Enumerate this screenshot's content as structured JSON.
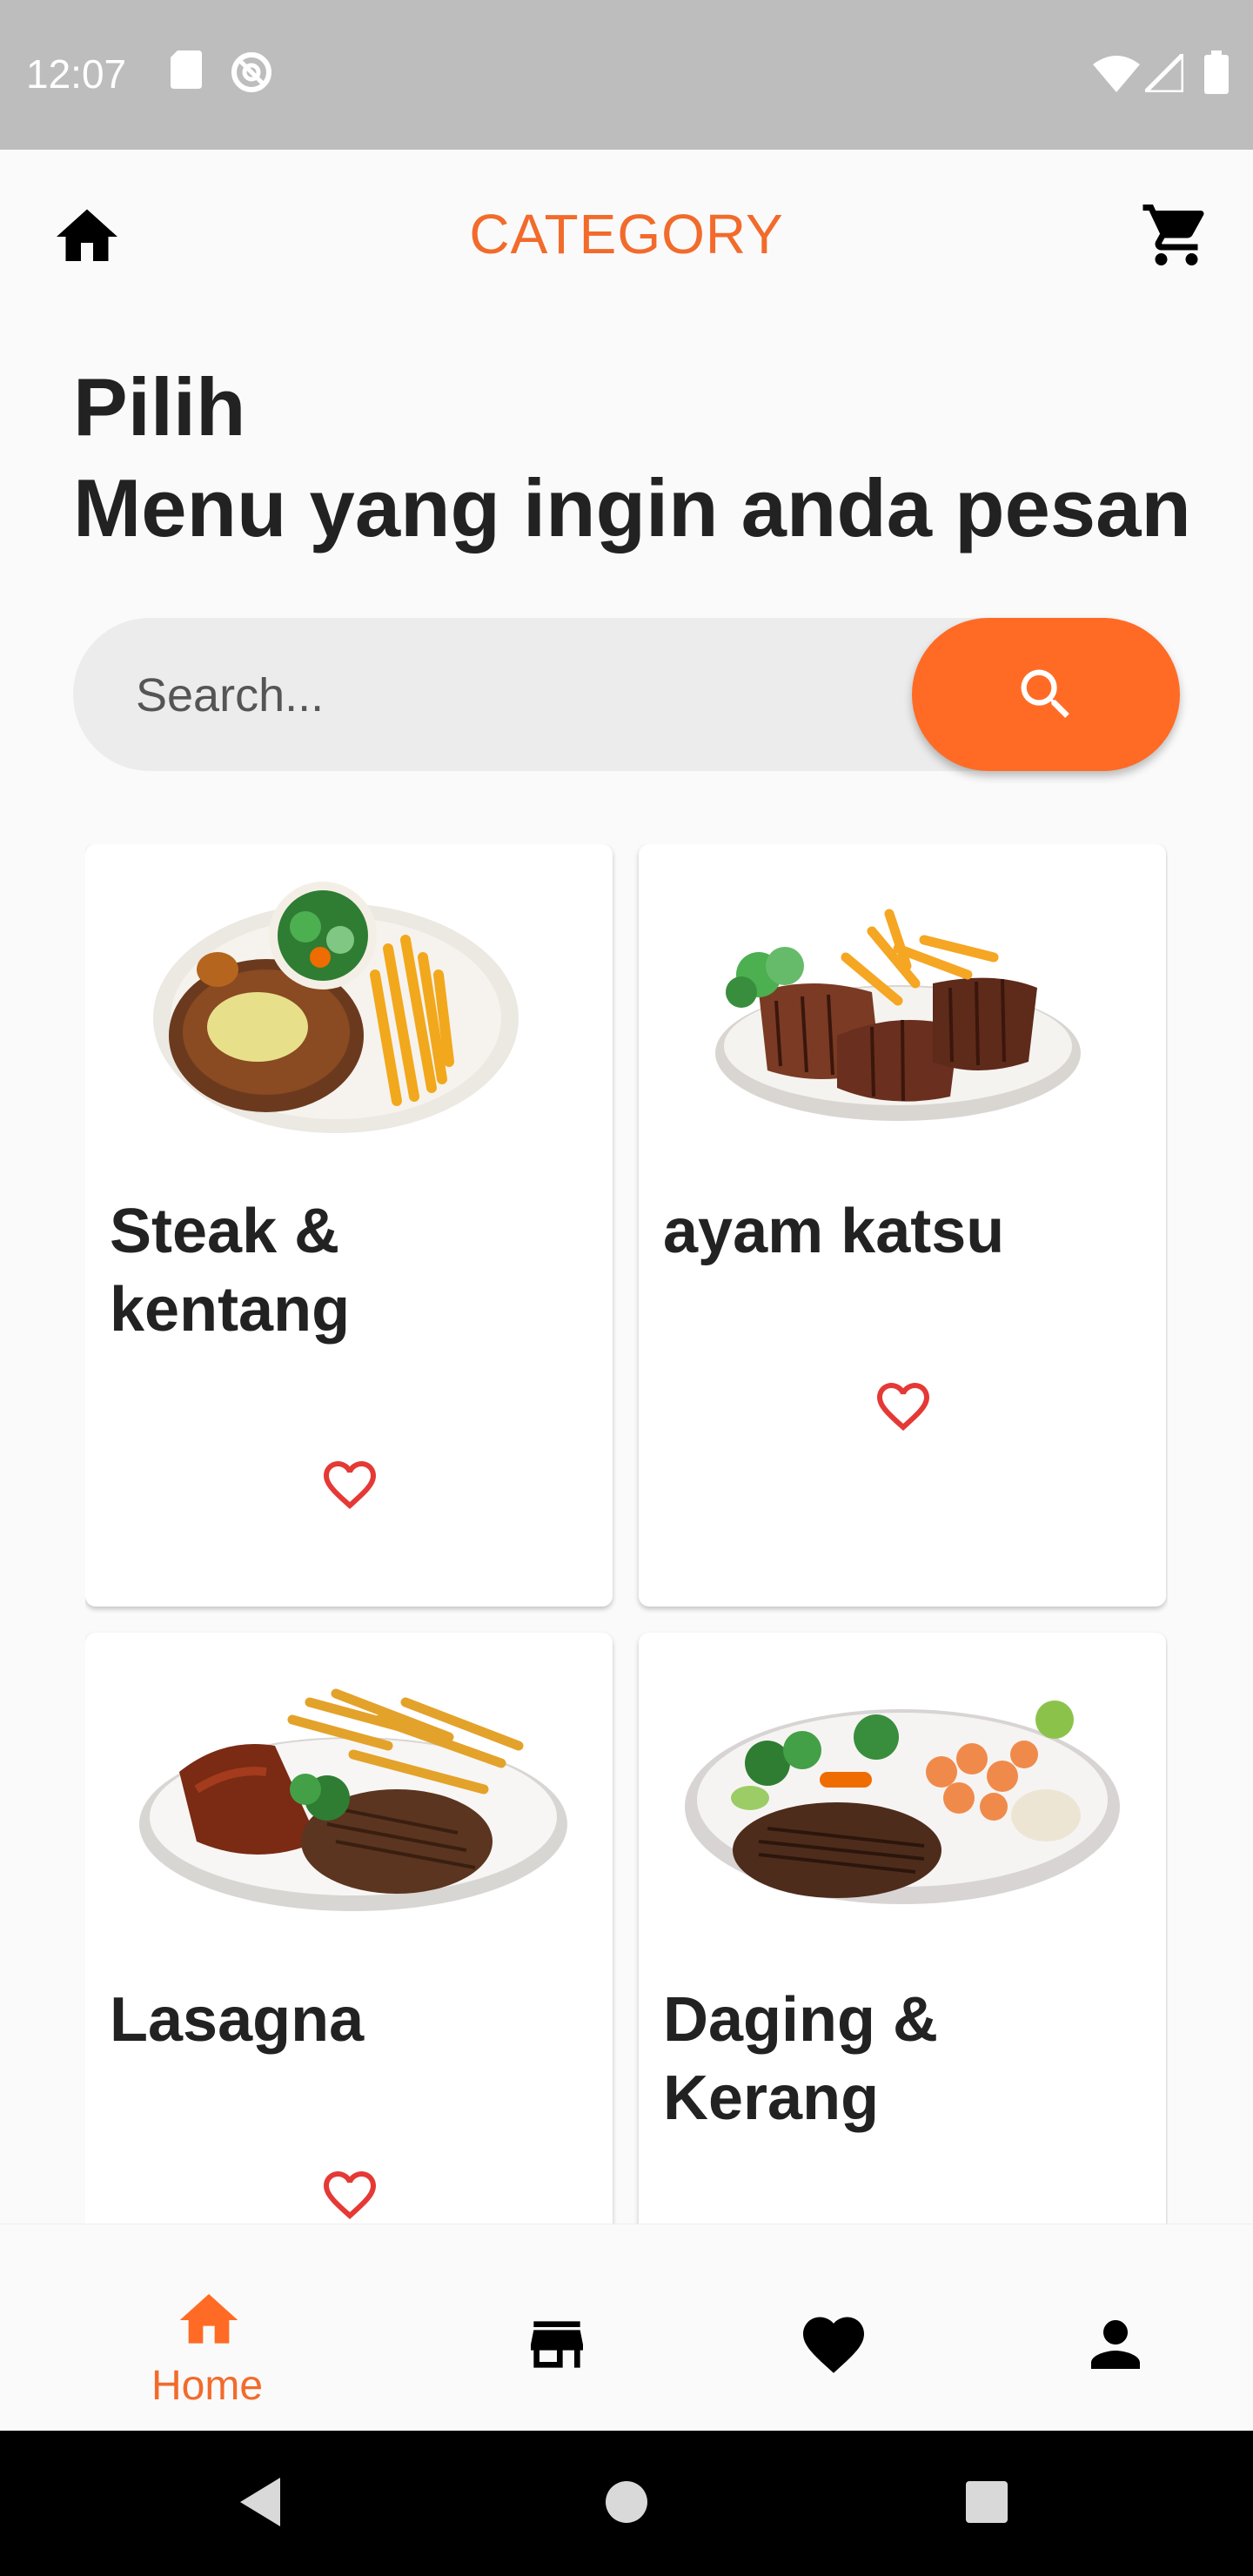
{
  "status_bar": {
    "time": "12:07"
  },
  "app_bar": {
    "title": "CATEGORY"
  },
  "heading": {
    "line1": "Pilih",
    "line2": "Menu yang ingin anda pesan"
  },
  "search": {
    "placeholder": "Search..."
  },
  "menu_items": [
    {
      "name": "Steak & kentang"
    },
    {
      "name": "ayam katsu"
    },
    {
      "name": "Lasagna"
    },
    {
      "name": "Daging & Kerang"
    }
  ],
  "bottom_nav": {
    "items": [
      {
        "label": "Home",
        "icon": "home-icon",
        "active": true
      },
      {
        "label": "",
        "icon": "store-icon",
        "active": false
      },
      {
        "label": "",
        "icon": "heart-icon",
        "active": false
      },
      {
        "label": "",
        "icon": "person-icon",
        "active": false
      }
    ]
  },
  "colors": {
    "accent": "#ff6b25",
    "title": "#f26b2b",
    "heart": "#e53935"
  }
}
